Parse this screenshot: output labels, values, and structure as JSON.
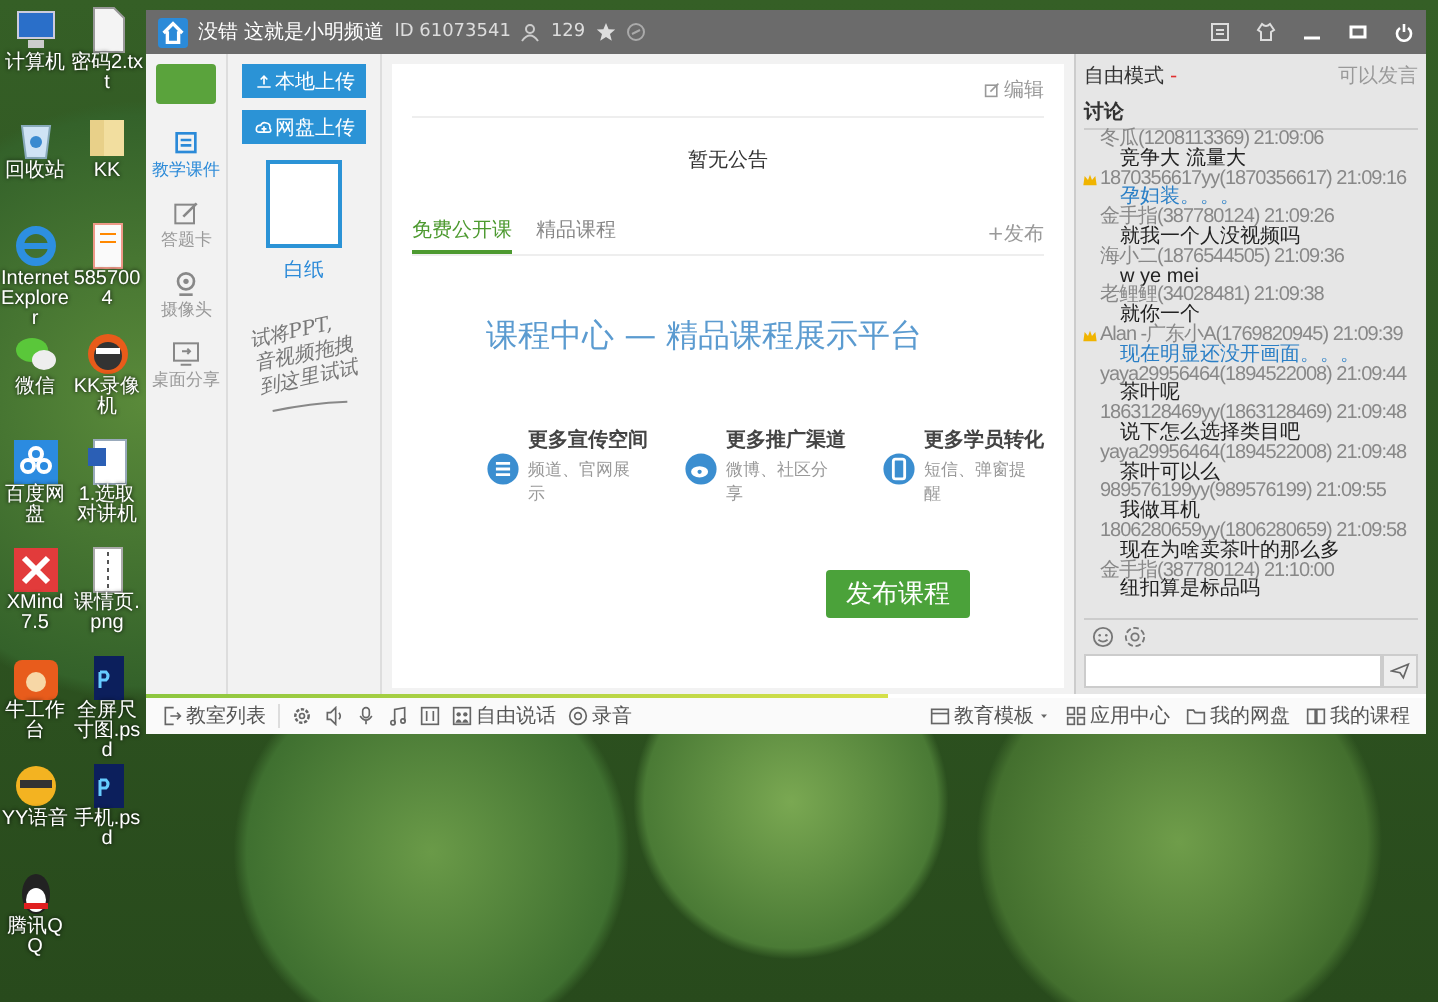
{
  "desktop": {
    "column_1": [
      {
        "label": "计算机"
      },
      {
        "label": "回收站"
      },
      {
        "label": "Internet Explorer"
      },
      {
        "label": "微信"
      },
      {
        "label": "百度网盘"
      },
      {
        "label": "XMind 7.5"
      },
      {
        "label": "牛工作台"
      },
      {
        "label": "YY语音"
      },
      {
        "label": "腾讯QQ"
      }
    ],
    "column_2": [
      {
        "label": "密码2.txt"
      },
      {
        "label": "KK"
      },
      {
        "label": "5857004"
      },
      {
        "label": "KK录像机"
      },
      {
        "label": "1.选取对讲机"
      },
      {
        "label": "课情页.png"
      },
      {
        "label": "全屏尺寸图.psd"
      },
      {
        "label": "手机.psd"
      }
    ]
  },
  "window": {
    "title": "没错 这就是小明频道",
    "id": "ID 61073541",
    "members": "129"
  },
  "sidebar": {
    "items": [
      {
        "label": "教学课件",
        "selected": true
      },
      {
        "label": "答题卡",
        "selected": false
      },
      {
        "label": "摄像头",
        "selected": false
      },
      {
        "label": "桌面分享",
        "selected": false
      }
    ]
  },
  "files": {
    "buttons": [
      "本地上传",
      "网盘上传"
    ],
    "thumbnail": "白纸",
    "hint_lines": [
      "试将PPT,",
      "音视频拖拽",
      "到这里试试"
    ]
  },
  "main": {
    "edit": "编辑",
    "notice": "暂无公告",
    "tabs": [
      {
        "label": "免费公开课",
        "selected": true
      },
      {
        "label": "精品课程",
        "selected": false
      }
    ],
    "publish_link": "+发布",
    "headline": "课程中心 — 精品课程展示平台",
    "features": [
      {
        "title": "更多宣传空间",
        "subtitle": "频道、官网展示"
      },
      {
        "title": "更多推广渠道",
        "subtitle": "微博、社区分享"
      },
      {
        "title": "更多学员转化",
        "subtitle": "短信、弹窗提醒"
      }
    ],
    "publish_button": "发布课程"
  },
  "chat": {
    "mode": "自由模式",
    "mode_caret": "-",
    "permission": "可以发言",
    "heading": "讨论",
    "messages": [
      {
        "user": "冬瓜(1208113369) 21:09:06",
        "text": "竞争大  流量大",
        "badge": false,
        "highlight": false
      },
      {
        "user": "1870356617yy(1870356617) 21:09:16",
        "text": "孕妇装。。。",
        "badge": true,
        "highlight": true
      },
      {
        "user": "金手指(387780124) 21:09:26",
        "text": "就我一个人没视频吗",
        "badge": false,
        "highlight": false
      },
      {
        "user": "海小二(1876544505) 21:09:36",
        "text": "w ye mei",
        "badge": false,
        "highlight": false
      },
      {
        "user": "老鲤鲤(34028481) 21:09:38",
        "text": "就你一个",
        "badge": false,
        "highlight": false
      },
      {
        "user": "Alan -广东小A(1769820945) 21:09:39",
        "text": "现在明显还没开画面。。。",
        "badge": true,
        "highlight": true
      },
      {
        "user": "yaya29956464(1894522008) 21:09:44",
        "text": "茶叶呢",
        "badge": false,
        "highlight": false
      },
      {
        "user": "1863128469yy(1863128469) 21:09:48",
        "text": "说下怎么选择类目吧",
        "badge": false,
        "highlight": false
      },
      {
        "user": "yaya29956464(1894522008) 21:09:48",
        "text": "茶叶可以么",
        "badge": false,
        "highlight": false
      },
      {
        "user": "989576199yy(989576199) 21:09:55",
        "text": "我做耳机",
        "badge": false,
        "highlight": false
      },
      {
        "user": "1806280659yy(1806280659) 21:09:58",
        "text": "现在为啥卖茶叶的那么多",
        "badge": false,
        "highlight": false
      },
      {
        "user": "金手指(387780124) 21:10:00",
        "text": "纽扣算是标品吗",
        "badge": false,
        "highlight": false
      }
    ]
  },
  "progress": {
    "level": 0.58
  },
  "toolbar": {
    "left": "教室列表",
    "talk": "自由说话",
    "record": "录音",
    "right": [
      "教育模板",
      "应用中心",
      "我的网盘",
      "我的课程"
    ]
  }
}
